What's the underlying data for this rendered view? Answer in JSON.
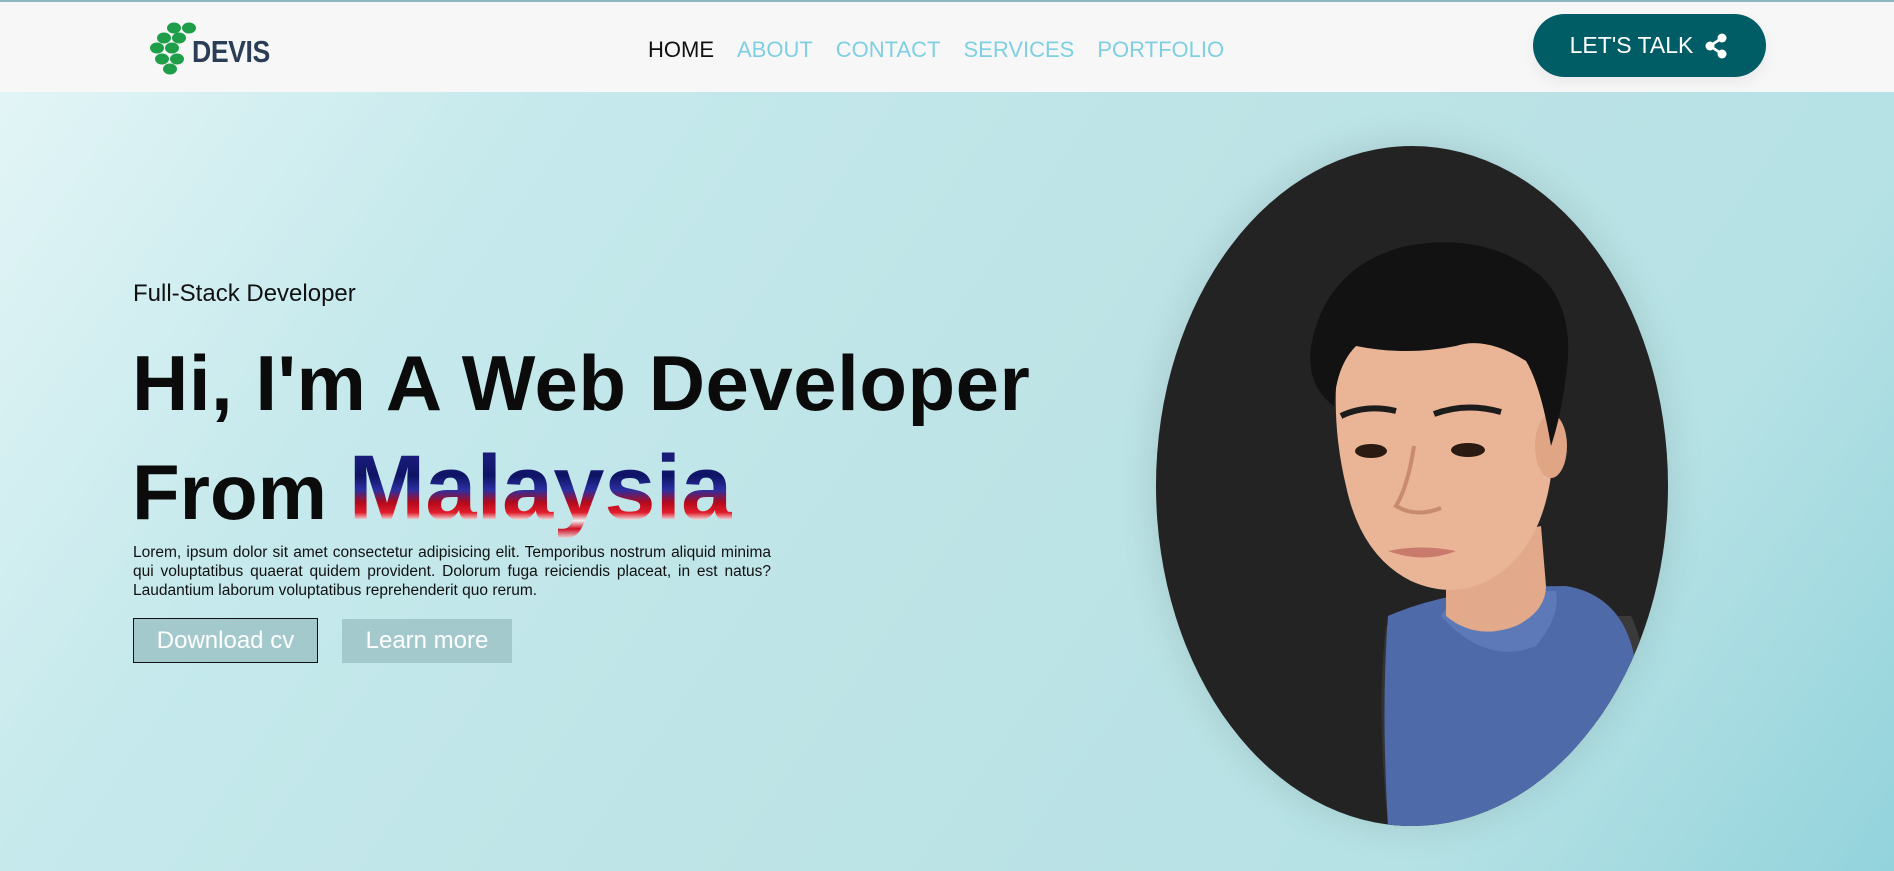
{
  "header": {
    "logo_text": "DEVIS",
    "nav": [
      {
        "label": "HOME",
        "active": true
      },
      {
        "label": "ABOUT",
        "active": false
      },
      {
        "label": "CONTACT",
        "active": false
      },
      {
        "label": "SERVICES",
        "active": false
      },
      {
        "label": "PORTFOLIO",
        "active": false
      }
    ],
    "cta_label": "LET'S TALK",
    "cta_icon": "share-icon"
  },
  "hero": {
    "subtitle": "Full-Stack Developer",
    "headline_line1": "Hi, I'm A Web Developer",
    "headline_from": "From",
    "headline_country": "Malaysia",
    "description": "Lorem, ipsum dolor sit amet consectetur adipisicing elit. Temporibus nostrum aliquid minima qui voluptatibus quaerat quidem provident. Dolorum fuga reiciendis placeat, in est natus? Laudantium laborum voluptatibus reprehenderit quo rerum.",
    "download_label": "Download cv",
    "learn_label": "Learn more"
  },
  "colors": {
    "accent": "#005d66",
    "nav_link": "#7fcfe2",
    "button_bg": "#a3c9cd",
    "logo_green": "#1e9e48",
    "logo_text": "#2b3e55"
  }
}
